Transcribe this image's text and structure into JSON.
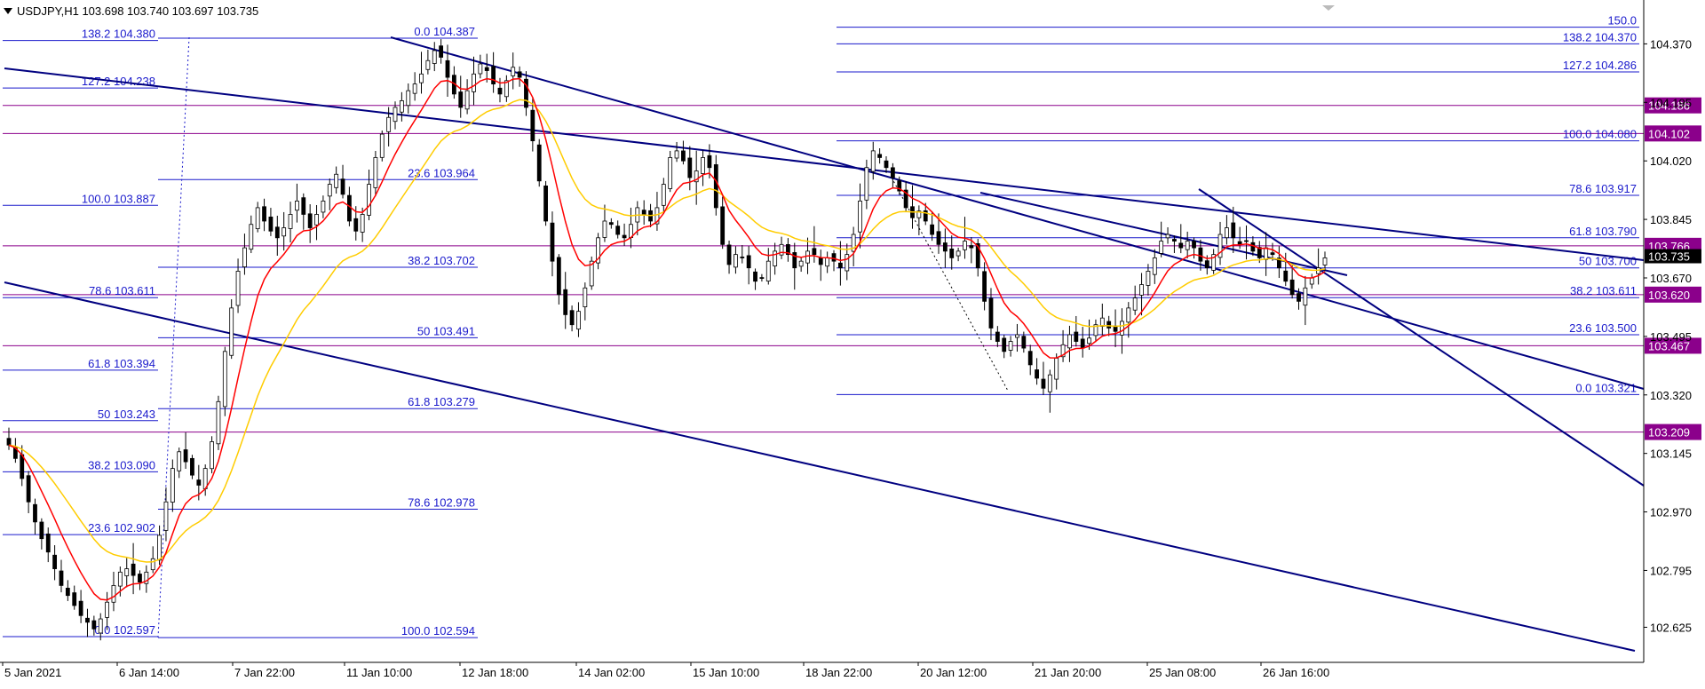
{
  "header": {
    "symbol_line": "USDJPY,H1  103.698 103.740 103.697 103.735"
  },
  "colors": {
    "fib": "#1a1acc",
    "channel": "#000080",
    "hline": "#8b008b",
    "ema_fast": "#ff0000",
    "ema_slow": "#ffcc00",
    "candle": "#000000",
    "price_tag": "#000000"
  },
  "chart_data": {
    "type": "candlestick",
    "symbol": "USDJPY",
    "timeframe": "H1",
    "ohlc_last": {
      "open": 103.698,
      "high": 103.74,
      "low": 103.697,
      "close": 103.735
    },
    "ylim": [
      102.52,
      104.48
    ],
    "y_ticks": [
      "104.370",
      "104.195",
      "104.020",
      "103.845",
      "103.670",
      "103.495",
      "103.320",
      "103.145",
      "102.970",
      "102.795",
      "102.625"
    ],
    "x_ticks": [
      "5 Jan 2021",
      "6 Jan 14:00",
      "7 Jan 22:00",
      "11 Jan 10:00",
      "12 Jan 18:00",
      "14 Jan 02:00",
      "15 Jan 10:00",
      "18 Jan 22:00",
      "20 Jan 12:00",
      "21 Jan 20:00",
      "25 Jan 08:00",
      "26 Jan 16:00"
    ],
    "current_price": "103.735",
    "horizontal_levels": [
      "104.186",
      "104.102",
      "103.766",
      "103.620",
      "103.467",
      "103.209"
    ],
    "fib_sets": [
      {
        "name": "left",
        "levels": [
          {
            "label": "138.2 104.380",
            "price": 104.38
          },
          {
            "label": "127.2 104.238",
            "price": 104.238
          },
          {
            "label": "100.0 103.887",
            "price": 103.887
          },
          {
            "label": "78.6 103.611",
            "price": 103.611
          },
          {
            "label": "61.8 103.394",
            "price": 103.394
          },
          {
            "label": "50 103.243",
            "price": 103.243
          },
          {
            "label": "38.2 103.090",
            "price": 103.09
          },
          {
            "label": "23.6 102.902",
            "price": 102.902
          },
          {
            "label": "0.0 102.597",
            "price": 102.597
          }
        ]
      },
      {
        "name": "middle",
        "levels": [
          {
            "label": "0.0 104.387",
            "price": 104.387
          },
          {
            "label": "23.6 103.964",
            "price": 103.964
          },
          {
            "label": "38.2 103.702",
            "price": 103.702
          },
          {
            "label": "50 103.491",
            "price": 103.491
          },
          {
            "label": "61.8 103.279",
            "price": 103.279
          },
          {
            "label": "78.6 102.978",
            "price": 102.978
          },
          {
            "label": "100.0 102.594",
            "price": 102.594
          }
        ]
      },
      {
        "name": "right",
        "levels": [
          {
            "label": "150.0",
            "price": 104.42
          },
          {
            "label": "138.2 104.370",
            "price": 104.37
          },
          {
            "label": "127.2 104.286",
            "price": 104.286
          },
          {
            "label": "100.0 104.080",
            "price": 104.08
          },
          {
            "label": "78.6 103.917",
            "price": 103.917
          },
          {
            "label": "61.8 103.790",
            "price": 103.79
          },
          {
            "label": "50 103.700",
            "price": 103.7
          },
          {
            "label": "38.2 103.611",
            "price": 103.611
          },
          {
            "label": "23.6 103.500",
            "price": 103.5
          },
          {
            "label": "0.0 103.321",
            "price": 103.321
          }
        ]
      }
    ],
    "closes": [
      103.17,
      103.13,
      103.07,
      103.0,
      102.94,
      102.89,
      102.85,
      102.8,
      102.75,
      102.72,
      102.69,
      102.66,
      102.64,
      102.62,
      102.65,
      102.7,
      102.75,
      102.79,
      102.8,
      102.78,
      102.76,
      102.79,
      102.83,
      102.9,
      103.0,
      103.1,
      103.15,
      103.12,
      103.08,
      103.05,
      103.1,
      103.18,
      103.3,
      103.45,
      103.58,
      103.69,
      103.76,
      103.83,
      103.88,
      103.84,
      103.81,
      103.79,
      103.82,
      103.86,
      103.9,
      103.86,
      103.82,
      103.86,
      103.9,
      103.95,
      103.98,
      103.92,
      103.84,
      103.81,
      103.86,
      103.95,
      104.03,
      104.1,
      104.15,
      104.18,
      104.2,
      104.23,
      104.25,
      104.28,
      104.32,
      104.35,
      104.33,
      104.27,
      104.22,
      104.18,
      104.23,
      104.28,
      104.31,
      104.29,
      104.25,
      104.22,
      104.26,
      104.3,
      104.27,
      104.18,
      104.08,
      103.96,
      103.84,
      103.72,
      103.62,
      103.56,
      103.53,
      103.57,
      103.64,
      103.72,
      103.79,
      103.84,
      103.83,
      103.8,
      103.79,
      103.83,
      103.88,
      103.86,
      103.84,
      103.88,
      103.95,
      104.03,
      104.05,
      104.02,
      103.97,
      103.99,
      104.03,
      104.0,
      103.88,
      103.77,
      103.71,
      103.74,
      103.73,
      103.7,
      103.66,
      103.67,
      103.72,
      103.75,
      103.77,
      103.74,
      103.7,
      103.72,
      103.75,
      103.74,
      103.71,
      103.73,
      103.72,
      103.7,
      103.74,
      103.8,
      103.9,
      104.0,
      104.05,
      104.03,
      104.0,
      103.97,
      103.93,
      103.88,
      103.85,
      103.87,
      103.84,
      103.8,
      103.77,
      103.75,
      103.73,
      103.75,
      103.78,
      103.76,
      103.7,
      103.6,
      103.52,
      103.48,
      103.45,
      103.48,
      103.5,
      103.46,
      103.41,
      103.37,
      103.34,
      103.38,
      103.43,
      103.47,
      103.5,
      103.48,
      103.46,
      103.49,
      103.53,
      103.55,
      103.52,
      103.51,
      103.54,
      103.58,
      103.61,
      103.65,
      103.69,
      103.73,
      103.78,
      103.8,
      103.78,
      103.76,
      103.78,
      103.76,
      103.72,
      103.7,
      103.74,
      103.8,
      103.82,
      103.79,
      103.77,
      103.78,
      103.75,
      103.73,
      103.76,
      103.74,
      103.7,
      103.66,
      103.62,
      103.6,
      103.64,
      103.67,
      103.7,
      103.73
    ]
  }
}
